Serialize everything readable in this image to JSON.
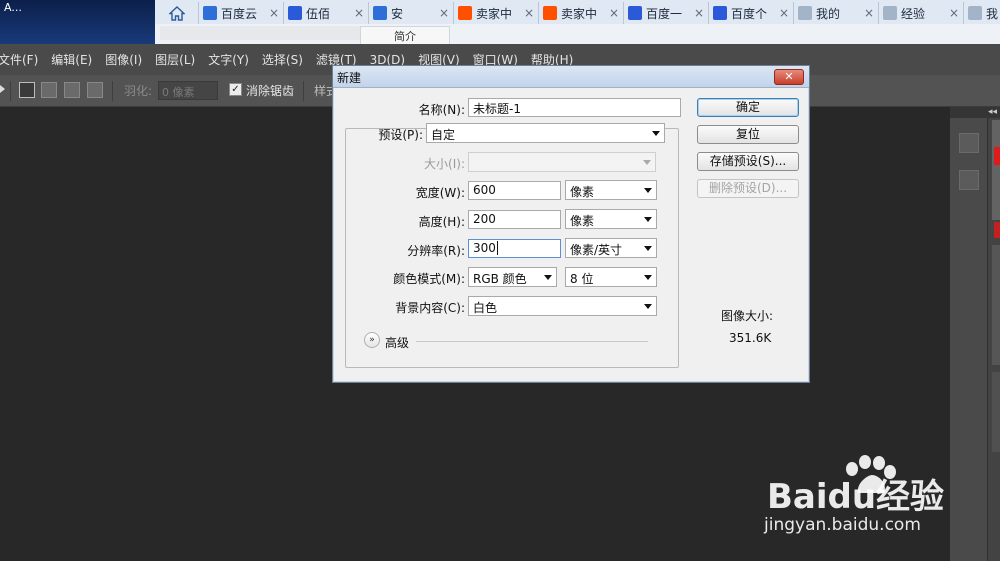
{
  "app_title": "A...",
  "browser_tabs": [
    {
      "label": "百度云",
      "fav": "baidu-cloud",
      "color": "#2d6fd6"
    },
    {
      "label": "伍佰",
      "fav": "baidu-paw",
      "color": "#2b5ad8"
    },
    {
      "label": "安",
      "fav": "headphone",
      "color": "#2d6fd6"
    },
    {
      "label": "卖家中",
      "fav": "taobao",
      "color": "#ff5000"
    },
    {
      "label": "卖家中",
      "fav": "taobao",
      "color": "#ff5000"
    },
    {
      "label": "百度一",
      "fav": "baidu-paw",
      "color": "#2b5ad8"
    },
    {
      "label": "百度个",
      "fav": "baidu-paw",
      "color": "#2b5ad8"
    },
    {
      "label": "我的",
      "fav": "page",
      "color": "#a3b3c8"
    },
    {
      "label": "经验",
      "fav": "page",
      "color": "#a3b3c8"
    },
    {
      "label": "我",
      "fav": "page",
      "color": "#a3b3c8"
    }
  ],
  "tab_close": "×",
  "under_tab_label": "简介",
  "menu": [
    "文件(F)",
    "编辑(E)",
    "图像(I)",
    "图层(L)",
    "文字(Y)",
    "选择(S)",
    "滤镜(T)",
    "3D(D)",
    "视图(V)",
    "窗口(W)",
    "帮助(H)"
  ],
  "options": {
    "feather_label": "羽化:",
    "feather_value": "0 像素",
    "antialias_checked": "✓",
    "antialias_label": "消除锯齿",
    "style_label": "样式"
  },
  "dialog": {
    "title": "新建",
    "close_label": "✕",
    "name_label": "名称(N):",
    "name_value": "未标题-1",
    "preset_label": "预设(P):",
    "preset_value": "自定",
    "size_label": "大小(I):",
    "size_value": "",
    "width_label": "宽度(W):",
    "width_value": "600",
    "width_unit": "像素",
    "height_label": "高度(H):",
    "height_value": "200",
    "height_unit": "像素",
    "resolution_label": "分辨率(R):",
    "resolution_value": "300",
    "resolution_unit": "像素/英寸",
    "colormode_label": "颜色模式(M):",
    "colormode_value": "RGB 颜色",
    "bitdepth_value": "8 位",
    "background_label": "背景内容(C):",
    "background_value": "白色",
    "advanced_label": "高级",
    "buttons": {
      "ok": "确定",
      "reset": "复位",
      "save_preset": "存储预设(S)...",
      "delete_preset": "删除预设(D)..."
    },
    "image_size_label": "图像大小:",
    "image_size_value": "351.6K"
  },
  "watermark": {
    "brand": "Baidu经验",
    "url": "jingyan.baidu.com"
  }
}
